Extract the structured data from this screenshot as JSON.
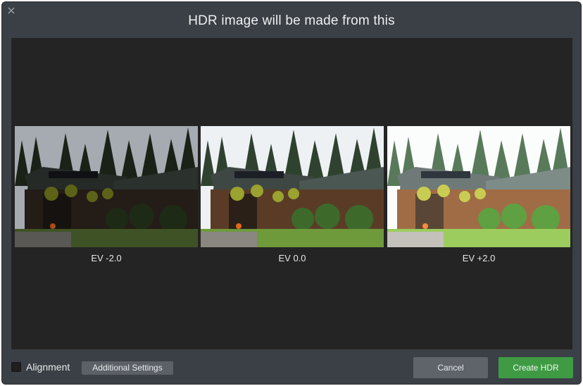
{
  "dialog": {
    "title": "HDR image will be made from this",
    "close_icon": "close-icon"
  },
  "frames": [
    {
      "label": "EV -2.0",
      "exposure": -2.0
    },
    {
      "label": "EV 0.0",
      "exposure": 0.0
    },
    {
      "label": "EV +2.0",
      "exposure": 2.0
    }
  ],
  "footer": {
    "alignment_label": "Alignment",
    "alignment_checked": false,
    "settings_label": "Additional Settings",
    "cancel_label": "Cancel",
    "create_label": "Create HDR"
  },
  "colors": {
    "dialog_bg": "#3b4046",
    "preview_bg": "#242424",
    "create_button": "#3f9a44",
    "cancel_button": "#5f646b"
  }
}
